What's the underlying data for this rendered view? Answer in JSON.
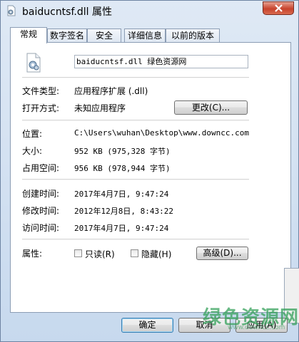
{
  "window": {
    "title": "baiducntsf.dll 属性"
  },
  "tabs": [
    {
      "label": "常规",
      "active": true
    },
    {
      "label": "数字签名",
      "active": false
    },
    {
      "label": "安全",
      "active": false
    },
    {
      "label": "详细信息",
      "active": false
    },
    {
      "label": "以前的版本",
      "active": false
    }
  ],
  "general": {
    "file_name": "baiducntsf.dll 绿色资源网",
    "type_label": "文件类型:",
    "type_value": "应用程序扩展 (.dll)",
    "opens_label": "打开方式:",
    "opens_value": "未知应用程序",
    "change_button": "更改(C)...",
    "location_label": "位置:",
    "location_value": "C:\\Users\\wuhan\\Desktop\\www.downcc.com",
    "size_label": "大小:",
    "size_value": "952 KB (975,328 字节)",
    "size_on_disk_label": "占用空间:",
    "size_on_disk_value": "956 KB (978,944 字节)",
    "created_label": "创建时间:",
    "created_value": "2017年4月7日, 9:47:24",
    "modified_label": "修改时间:",
    "modified_value": "2012年12月8日, 8:43:22",
    "accessed_label": "访问时间:",
    "accessed_value": "2017年4月7日, 9:47:24",
    "attributes_label": "属性:",
    "readonly_label": "只读(R)",
    "hidden_label": "隐藏(H)",
    "advanced_button": "高级(D)..."
  },
  "footer": {
    "ok": "确定",
    "cancel": "取消",
    "apply": "应用(A)"
  },
  "watermark": {
    "text": "绿色资源网",
    "url": "www.downcc.com"
  },
  "colors": {
    "close_red": "#c7432c",
    "watermark_green": "#34a05a"
  },
  "icons": {
    "title": "dll-file-icon",
    "file": "gear-file-icon",
    "close": "close-icon"
  }
}
